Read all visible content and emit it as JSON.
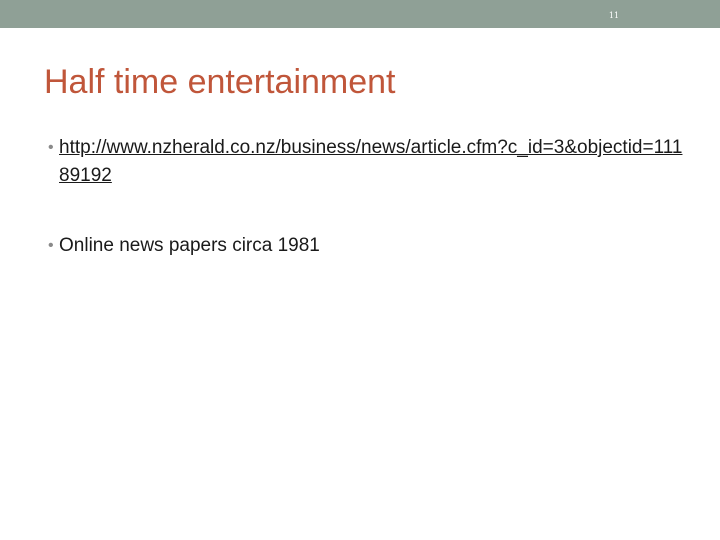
{
  "slide": {
    "number": "11",
    "title": "Half time entertainment",
    "bullets": {
      "marker": "•",
      "link": "http://www.nzherald.co.nz/business/news/article.cfm?c_id=3&objectid=11189192",
      "text": "Online news papers circa 1981"
    }
  },
  "colors": {
    "top_bar": "#8fa096",
    "title": "#c0563a",
    "body_text": "#1a1a1a",
    "bullet_marker": "#8a8a8a"
  }
}
